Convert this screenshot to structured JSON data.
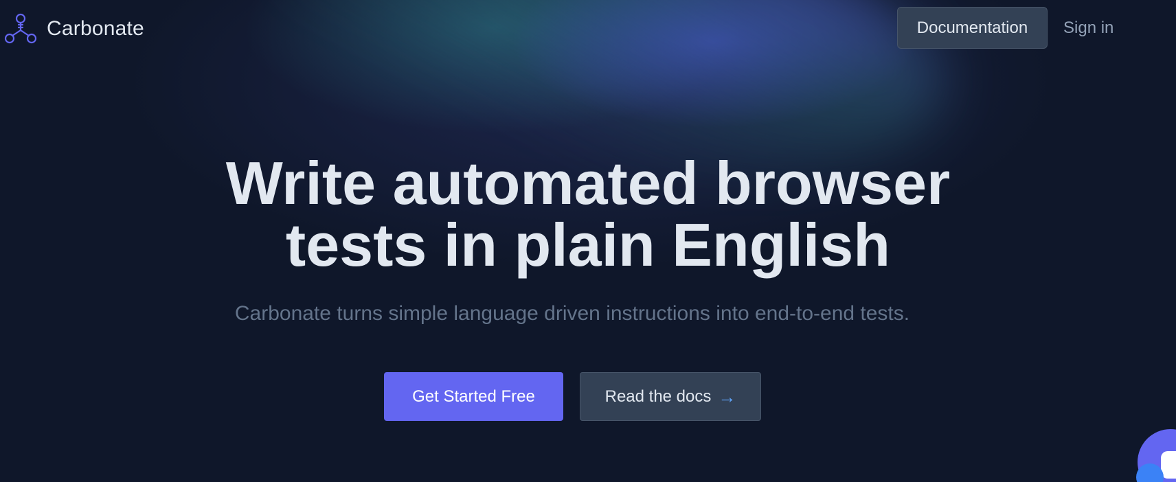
{
  "brand": {
    "name": "Carbonate",
    "logo_icon": "carbonate-molecule-icon",
    "accent_color": "#6366f1"
  },
  "nav": {
    "documentation_label": "Documentation",
    "signin_label": "Sign in"
  },
  "hero": {
    "headline_line1": "Write automated browser",
    "headline_line2": "tests in plain English",
    "subtitle": "Carbonate turns simple language driven instructions into end-to-end tests.",
    "primary_cta": "Get Started Free",
    "secondary_cta": "Read the docs",
    "secondary_cta_icon": "arrow-right-icon"
  },
  "widgets": {
    "chat_icon": "chat-bubble-icon"
  }
}
